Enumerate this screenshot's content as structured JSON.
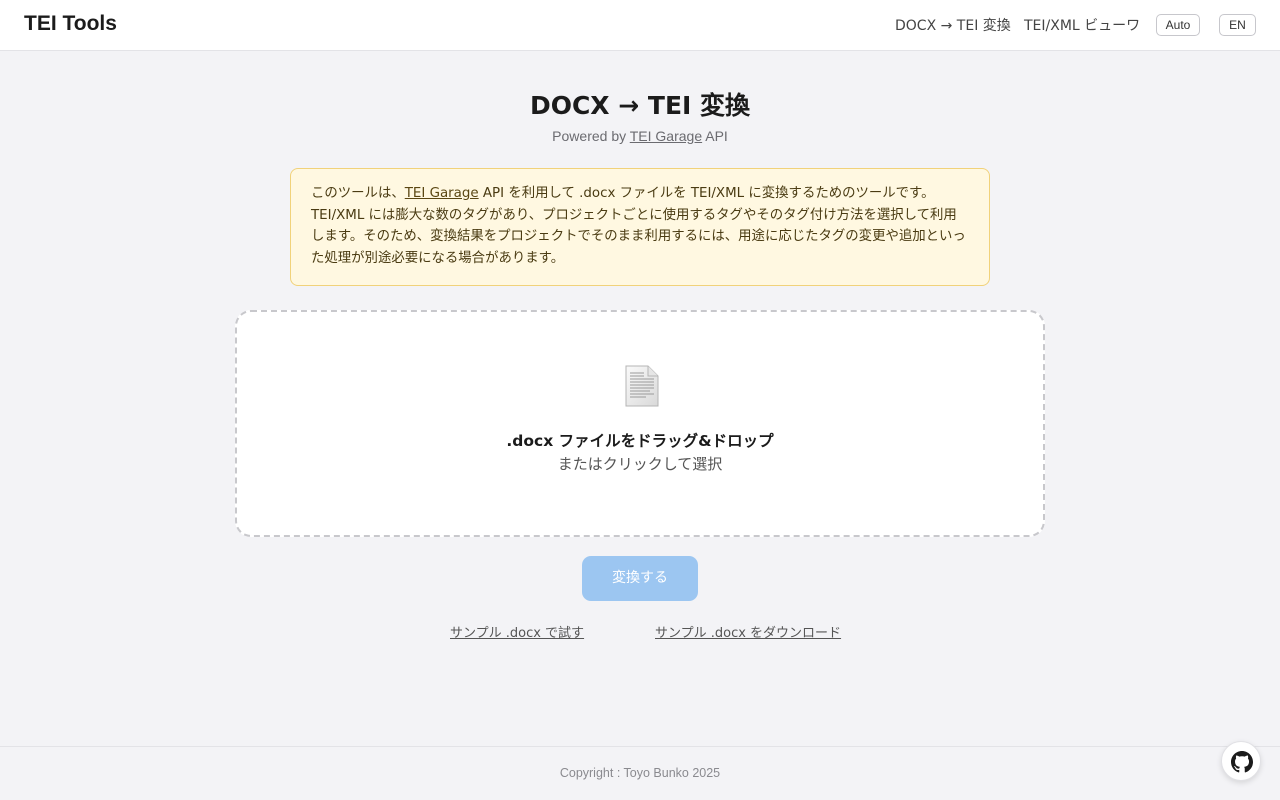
{
  "header": {
    "brand": "TEI Tools",
    "nav": {
      "docx_to_tei": "DOCX → TEI 変換",
      "tei_viewer": "TEI/XML ビューワ"
    },
    "theme_button": "Auto",
    "language_button": "EN"
  },
  "main": {
    "title": "DOCX → TEI 変換",
    "subtitle": {
      "prefix": "Powered by ",
      "link": "TEI Garage",
      "suffix": " API"
    },
    "notice": {
      "line1_prefix": "このツールは、",
      "line1_link": "TEI Garage",
      "line1_suffix": " API を利用して .docx ファイルを TEI/XML に変換するためのツールです。",
      "line2": "TEI/XML には膨大な数のタグがあり、プロジェクトごとに使用するタグやそのタグ付け方法を選択して利用します。そのため、変換結果をプロジェクトでそのまま利用するには、用途に応じたタグの変更や追加といった処理が別途必要になる場合があります。"
    },
    "dropzone": {
      "icon": "document-icon",
      "primary": ".docx ファイルをドラッグ&ドロップ",
      "secondary": "またはクリックして選択"
    },
    "convert_button": "変換する",
    "sample_try": "サンプル .docx で試す",
    "sample_download": "サンプル .docx をダウンロード"
  },
  "footer": {
    "copyright": "Copyright : Toyo Bunko 2025",
    "github_icon": "github-icon"
  },
  "colors": {
    "background": "#f3f3f6",
    "notice_bg": "#fff8e1",
    "notice_border": "#f1d27a",
    "button_disabled": "#9cc6f1"
  }
}
